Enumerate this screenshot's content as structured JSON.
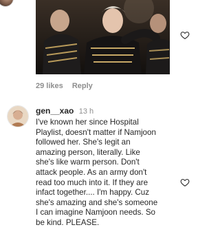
{
  "top_post": {
    "likes_label": "29 likes",
    "reply_label": "Reply"
  },
  "comment": {
    "username": "gen__xao",
    "time": "13 h",
    "lines": [
      "I've known her since Hospital",
      "Playlist, doesn't matter if Namjoon",
      "followed her. She's legit an",
      "amazing person, literally. Like",
      "she's like warm person. Don't",
      "attack people. As an army don't",
      "read too much into it. If they are",
      "infact together.... I'm happy. Cuz",
      "she's amazing and she's someone",
      "I can imagine Namjoon needs. So",
      "be kind. PLEASE."
    ]
  },
  "icons": {
    "like_top": "heart-outline-icon",
    "like_comment": "heart-outline-icon"
  }
}
